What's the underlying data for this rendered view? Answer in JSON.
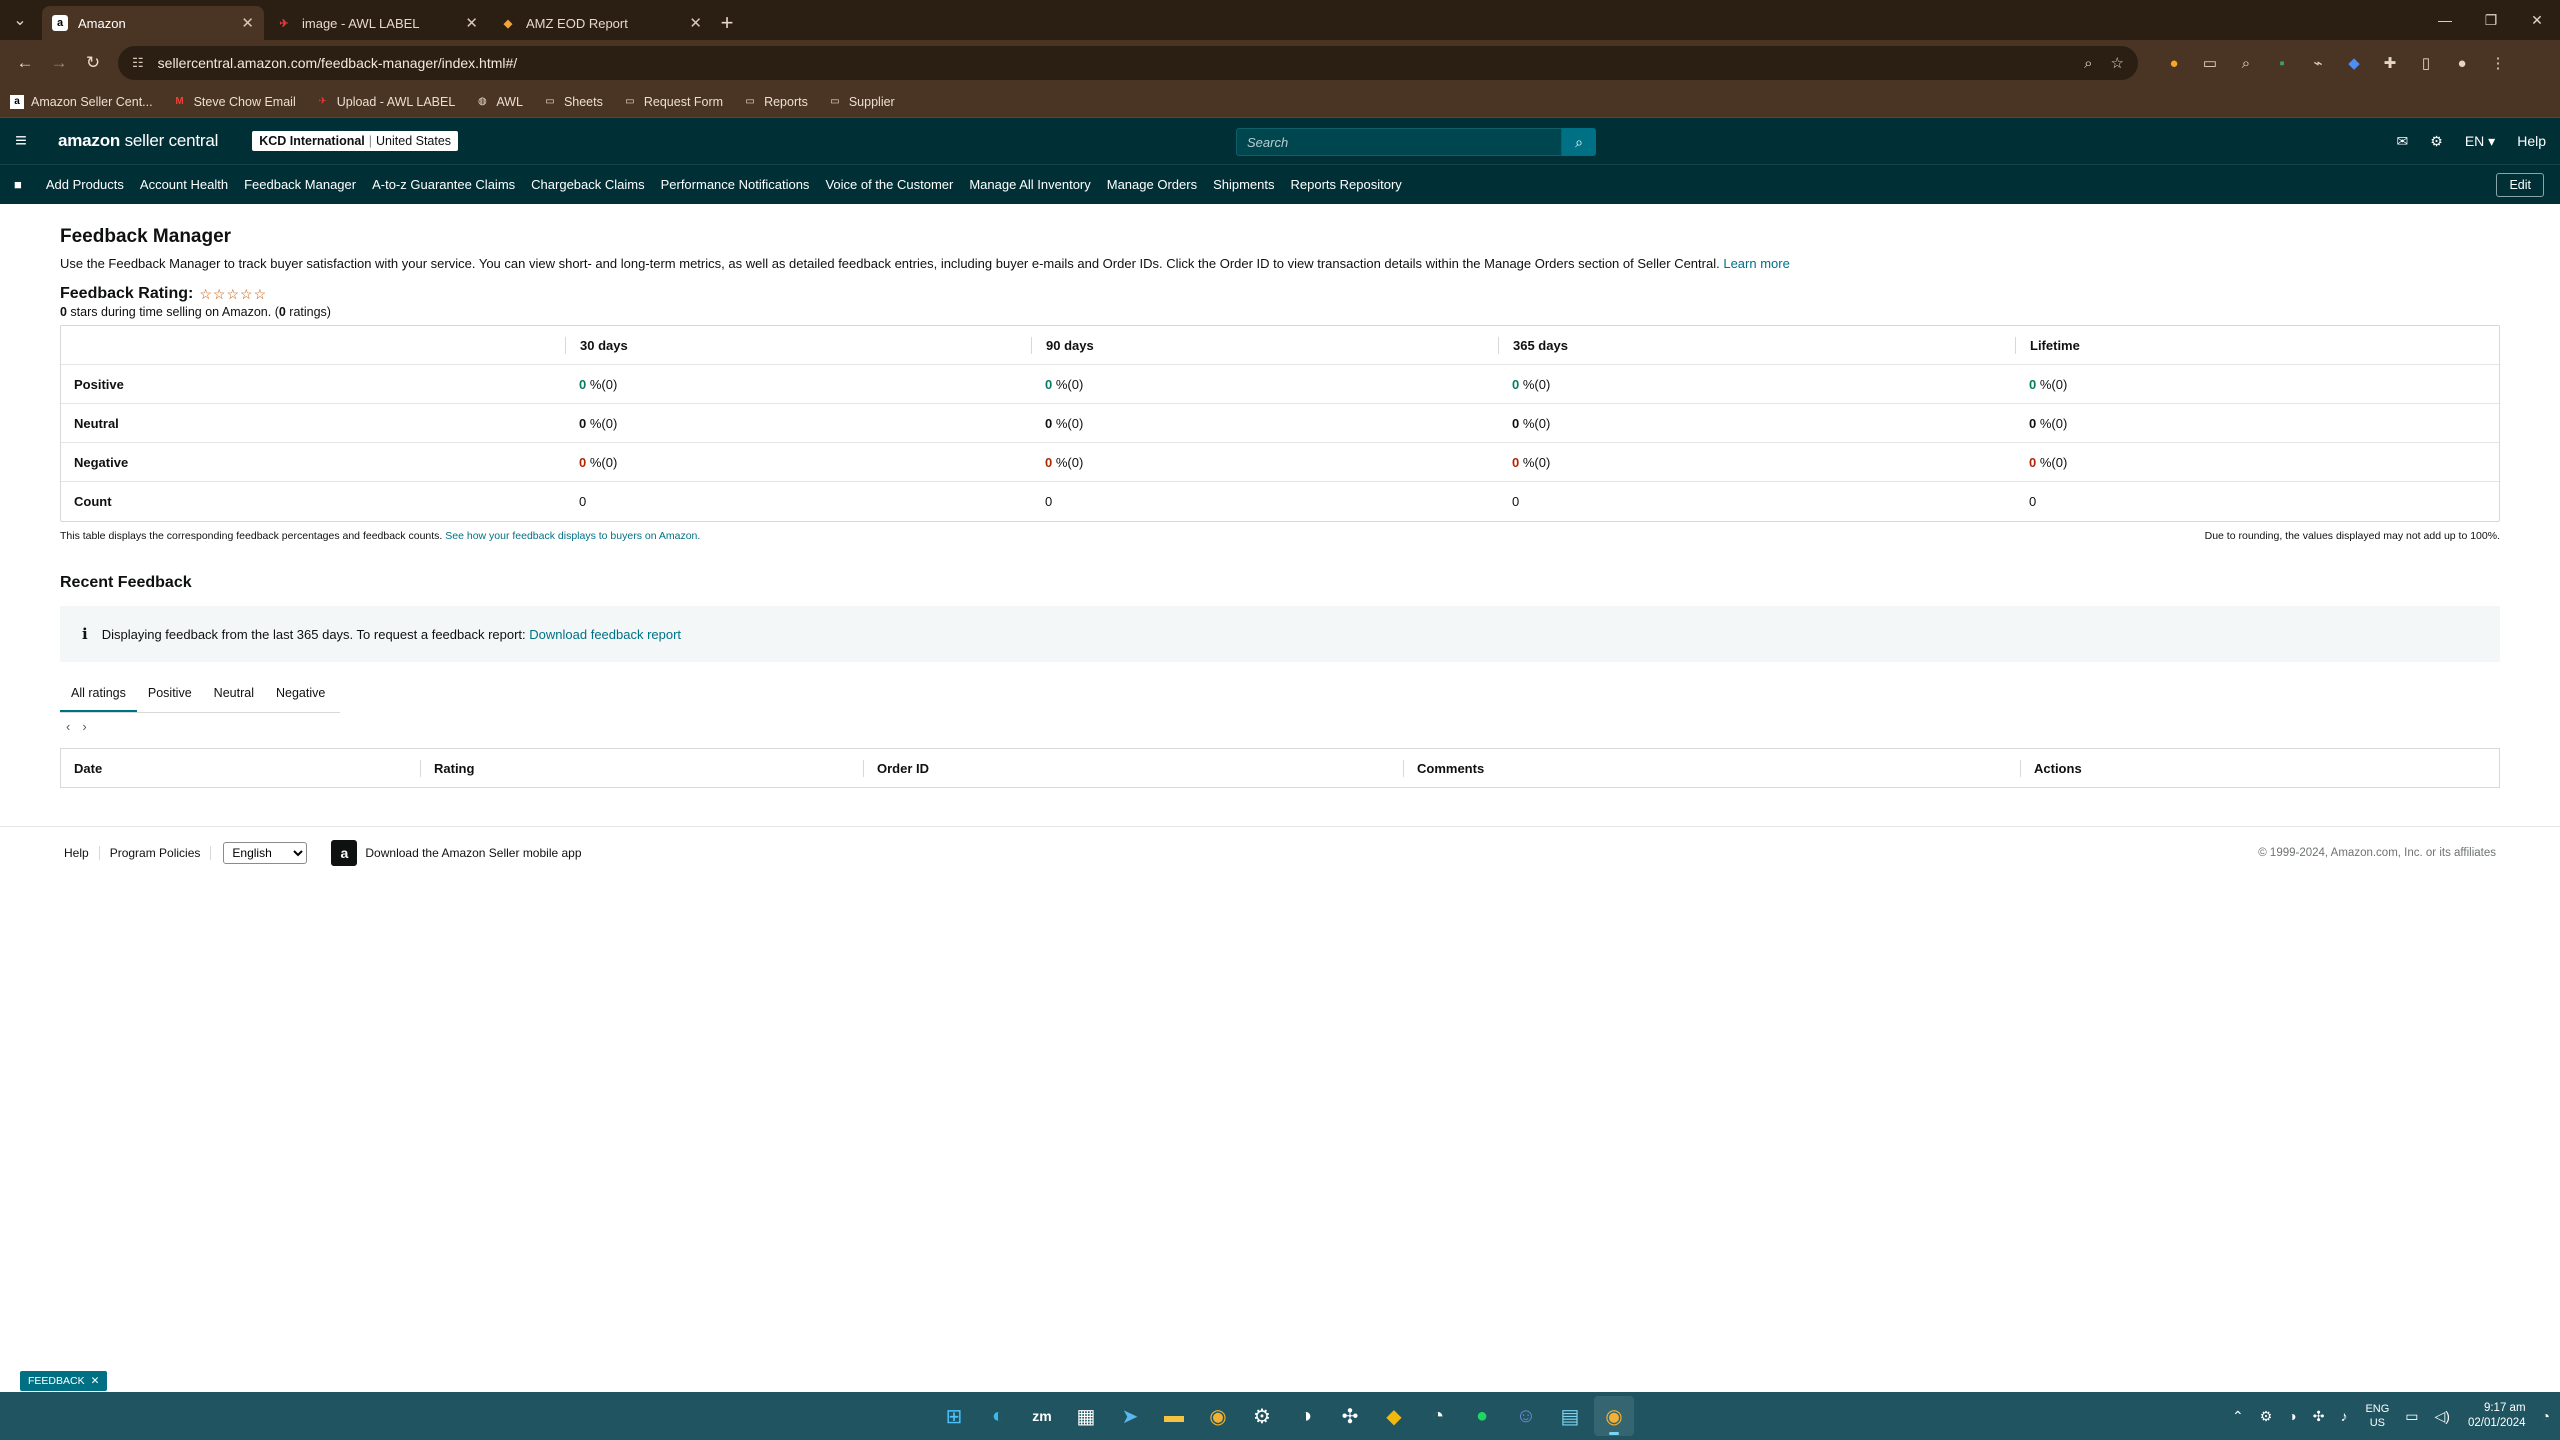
{
  "browser": {
    "tabs": [
      {
        "title": "Amazon",
        "favicon": "a"
      },
      {
        "title": "image - AWL LABEL",
        "favicon": "✈"
      },
      {
        "title": "AMZ EOD Report",
        "favicon": "◆"
      }
    ],
    "url": "sellercentral.amazon.com/feedback-manager/index.html#/",
    "bookmarks": [
      "Amazon Seller Cent...",
      "Steve Chow Email",
      "Upload - AWL LABEL",
      "AWL",
      "Sheets",
      "Request Form",
      "Reports",
      "Supplier"
    ]
  },
  "header": {
    "logo_bold": "amazon",
    "logo_rest": " seller central",
    "account_name": "KCD International",
    "account_region": "United States",
    "search_placeholder": "Search",
    "language": "EN ▾",
    "help": "Help"
  },
  "nav": {
    "links": [
      "Add Products",
      "Account Health",
      "Feedback Manager",
      "A-to-z Guarantee Claims",
      "Chargeback Claims",
      "Performance Notifications",
      "Voice of the Customer",
      "Manage All Inventory",
      "Manage Orders",
      "Shipments",
      "Reports Repository"
    ],
    "edit": "Edit"
  },
  "page": {
    "title": "Feedback Manager",
    "intro": "Use the Feedback Manager to track buyer satisfaction with your service. You can view short- and long-term metrics, as well as detailed feedback entries, including buyer e-mails and Order IDs. Click the Order ID to view transaction details within the Manage Orders section of Seller Central.",
    "learn_more": "Learn more",
    "rating_title": "Feedback Rating:",
    "stars": "☆☆☆☆☆",
    "rating_stars_value": "0",
    "rating_summary_mid": " stars during time selling on Amazon. (",
    "rating_count": "0",
    "rating_summary_end": " ratings)"
  },
  "feedback_table": {
    "columns": [
      "",
      "30 days",
      "90 days",
      "365 days",
      "Lifetime"
    ],
    "rows": [
      {
        "label": "Positive",
        "type": "pos",
        "cells": [
          {
            "num": "0",
            "rest": " %(0)"
          },
          {
            "num": "0",
            "rest": " %(0)"
          },
          {
            "num": "0",
            "rest": " %(0)"
          },
          {
            "num": "0",
            "rest": " %(0)"
          }
        ]
      },
      {
        "label": "Neutral",
        "type": "neu",
        "cells": [
          {
            "num": "0",
            "rest": " %(0)"
          },
          {
            "num": "0",
            "rest": " %(0)"
          },
          {
            "num": "0",
            "rest": " %(0)"
          },
          {
            "num": "0",
            "rest": " %(0)"
          }
        ]
      },
      {
        "label": "Negative",
        "type": "neg",
        "cells": [
          {
            "num": "0",
            "rest": " %(0)"
          },
          {
            "num": "0",
            "rest": " %(0)"
          },
          {
            "num": "0",
            "rest": " %(0)"
          },
          {
            "num": "0",
            "rest": " %(0)"
          }
        ]
      },
      {
        "label": "Count",
        "type": "count",
        "cells": [
          {
            "num": "",
            "rest": "0"
          },
          {
            "num": "",
            "rest": "0"
          },
          {
            "num": "",
            "rest": "0"
          },
          {
            "num": "",
            "rest": "0"
          }
        ]
      }
    ],
    "note_left": "This table displays the corresponding feedback percentages and feedback counts.",
    "note_left_link": "See how your feedback displays to buyers on Amazon.",
    "note_right": "Due to rounding, the values displayed may not add up to 100%."
  },
  "recent": {
    "title": "Recent Feedback",
    "info_text": "Displaying feedback from the last 365 days. To request a feedback report:",
    "info_link": "Download feedback report",
    "tabs": [
      "All ratings",
      "Positive",
      "Neutral",
      "Negative"
    ],
    "columns": [
      "Date",
      "Rating",
      "Order ID",
      "Comments",
      "Actions"
    ]
  },
  "footer": {
    "help": "Help",
    "policies": "Program Policies",
    "language": "English",
    "app": "Download the Amazon Seller mobile app",
    "copyright": "© 1999-2024, Amazon.com, Inc. or its affiliates"
  },
  "feedback_pill": "FEEDBACK",
  "taskbar": {
    "lang_top": "ENG",
    "lang_bottom": "US",
    "time": "9:17 am",
    "date": "02/01/2024"
  }
}
